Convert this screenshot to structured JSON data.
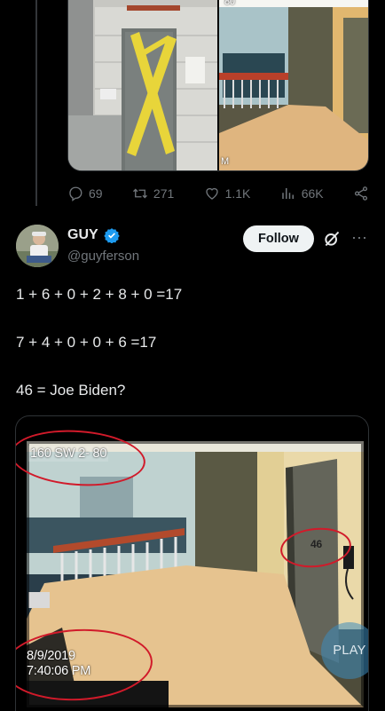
{
  "prev_tweet": {
    "media_overlay_text_top": "80",
    "media_overlay_corner": "M",
    "actions": {
      "replies": "69",
      "reposts": "271",
      "likes": "1.1K",
      "views": "66K"
    }
  },
  "tweet": {
    "author_name": "GUY",
    "author_handle": "@guyferson",
    "follow_label": "Follow",
    "lines": [
      "1 + 6 + 0 + 2 + 8 + 0 =17",
      "7 + 4 + 0 + 0 + 6 =17",
      "46 = Joe Biden?"
    ],
    "media": {
      "location_text": "160 SW 2- 80",
      "date_text": "8/9/2019",
      "time_text": "7:40:06 PM",
      "door_number": "46",
      "play_label": "PLAY"
    }
  },
  "colors": {
    "background": "#000000",
    "text": "#e7e9ea",
    "muted": "#71767b",
    "verified": "#1d9bf0",
    "annotation_red": "#d11a2a"
  },
  "icons": [
    "reply-icon",
    "repost-icon",
    "like-icon",
    "views-icon",
    "share-icon",
    "verified-icon",
    "grok-icon",
    "more-icon",
    "play-icon"
  ]
}
